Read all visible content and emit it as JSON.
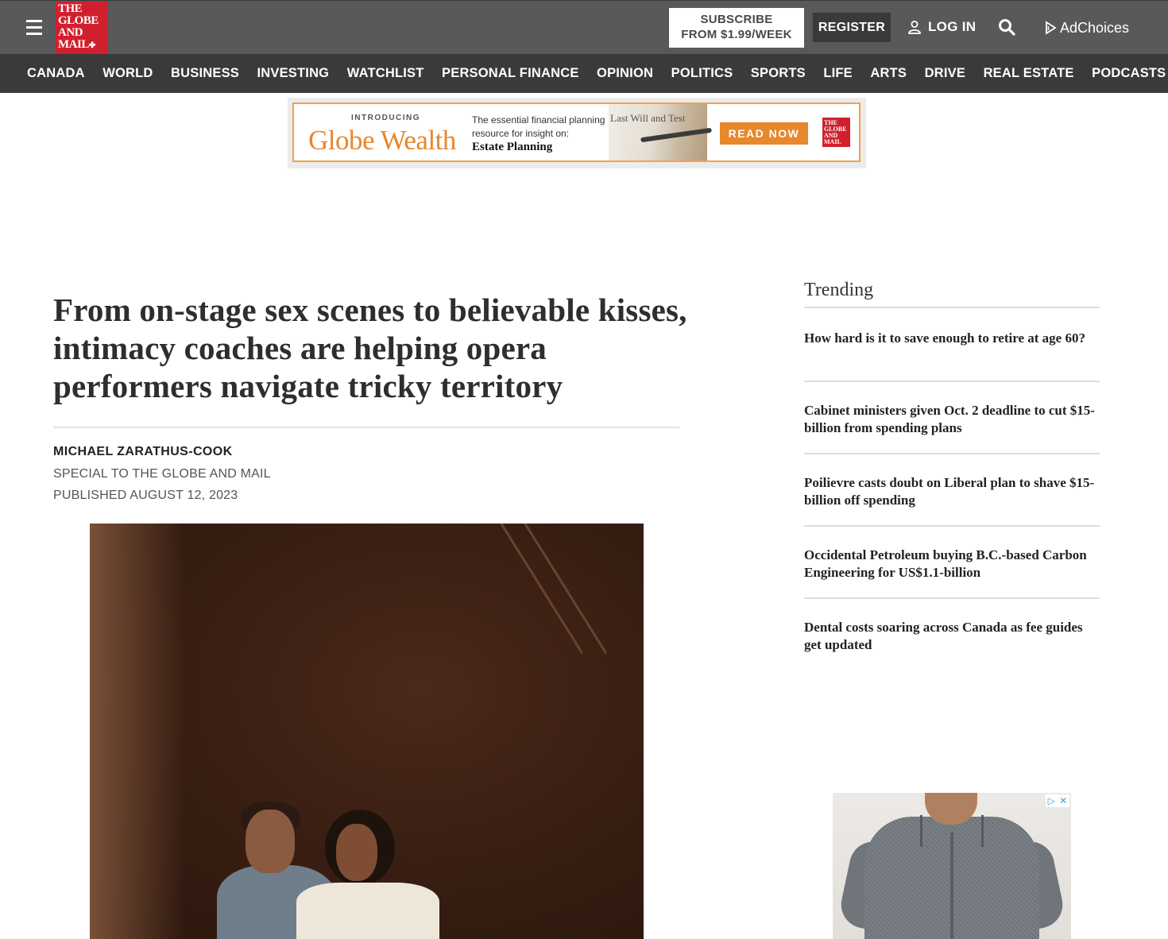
{
  "header": {
    "logo_lines": [
      "THE",
      "GLOBE",
      "AND",
      "MAIL"
    ],
    "subscribe_line1": "SUBSCRIBE",
    "subscribe_line2": "FROM $1.99/WEEK",
    "register_label": "REGISTER",
    "login_label": "LOG IN",
    "adchoices_label": "AdChoices",
    "icons": [
      "hamburger-menu-icon",
      "maple-leaf-icon",
      "user-icon",
      "search-icon",
      "adchoices-icon"
    ]
  },
  "nav": {
    "items": [
      "CANADA",
      "WORLD",
      "BUSINESS",
      "INVESTING",
      "WATCHLIST",
      "PERSONAL FINANCE",
      "OPINION",
      "POLITICS",
      "SPORTS",
      "LIFE",
      "ARTS",
      "DRIVE",
      "REAL ESTATE",
      "PODCASTS"
    ]
  },
  "banner_ad": {
    "intro": "INTRODUCING",
    "brand": "Globe Wealth",
    "desc_line": "The essential financial planning resource for insight on:",
    "desc_topic": "Estate Planning",
    "image_text": "Last Will and Test",
    "cta": "READ NOW",
    "logo_lines": [
      "THE",
      "GLOBE",
      "AND",
      "MAIL"
    ]
  },
  "article": {
    "headline": "From on-stage sex scenes to believable kisses, intimacy coaches are helping opera performers navigate tricky territory",
    "author": "MICHAEL ZARATHUS-COOK",
    "affiliation": "SPECIAL TO THE GLOBE AND MAIL",
    "published": "PUBLISHED AUGUST 12, 2023"
  },
  "sidebar": {
    "trending_title": "Trending",
    "trending": [
      "How hard is it to save enough to retire at age 60?",
      "Cabinet ministers given Oct. 2 deadline to cut $15-billion from spending plans",
      "Poilievre casts doubt on Liberal plan to shave $15-billion off spending",
      "Occidental Petroleum buying B.C.-based Carbon Engineering for US$1.1-billion",
      "Dental costs soaring across Canada as fee guides get updated"
    ]
  },
  "colors": {
    "topbar": "#58595b",
    "nav": "#3a3a3a",
    "logo_red": "#d0202e",
    "ad_orange": "#e8872b"
  }
}
